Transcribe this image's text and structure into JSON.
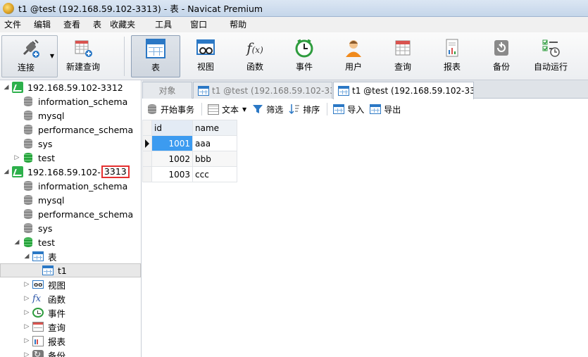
{
  "window": {
    "title": "t1 @test (192.168.59.102-3313) - 表 - Navicat Premium"
  },
  "menu": [
    "文件",
    "编辑",
    "查看",
    "表",
    "收藏夹",
    "工具",
    "窗口",
    "帮助"
  ],
  "toolbar": {
    "connect": "连接",
    "new_query": "新建查询",
    "table": "表",
    "view": "视图",
    "function": "函数",
    "event": "事件",
    "user": "用户",
    "query": "查询",
    "report": "报表",
    "backup": "备份",
    "automation": "自动运行"
  },
  "sidebar": {
    "conn1": "192.168.59.102-3312",
    "conn1_dbs": [
      "information_schema",
      "mysql",
      "performance_schema",
      "sys",
      "test"
    ],
    "conn2_prefix": "192.168.59.102-",
    "conn2_port": "3313",
    "conn2_dbs": [
      "information_schema",
      "mysql",
      "performance_schema",
      "sys",
      "test"
    ],
    "tables_group": "表",
    "table_t1": "t1",
    "groups": [
      "视图",
      "函数",
      "事件",
      "查询",
      "报表",
      "备份"
    ]
  },
  "tabs": {
    "objects": "对象",
    "tab1": "t1 @test (192.168.59.102-33...",
    "tab2": "t1 @test (192.168.59.102-33..."
  },
  "subtoolbar": {
    "begin_transaction": "开始事务",
    "text": "文本",
    "filter": "筛选",
    "sort": "排序",
    "import": "导入",
    "export": "导出"
  },
  "grid": {
    "columns": [
      "id",
      "name"
    ],
    "rows": [
      {
        "id": "1001",
        "name": "aaa"
      },
      {
        "id": "1002",
        "name": "bbb"
      },
      {
        "id": "1003",
        "name": "ccc"
      }
    ]
  },
  "colors": {
    "accent": "#2b78c5",
    "selection": "#3c9bf0",
    "highlight_box": "#e53030",
    "connection_green": "#2db04b"
  }
}
